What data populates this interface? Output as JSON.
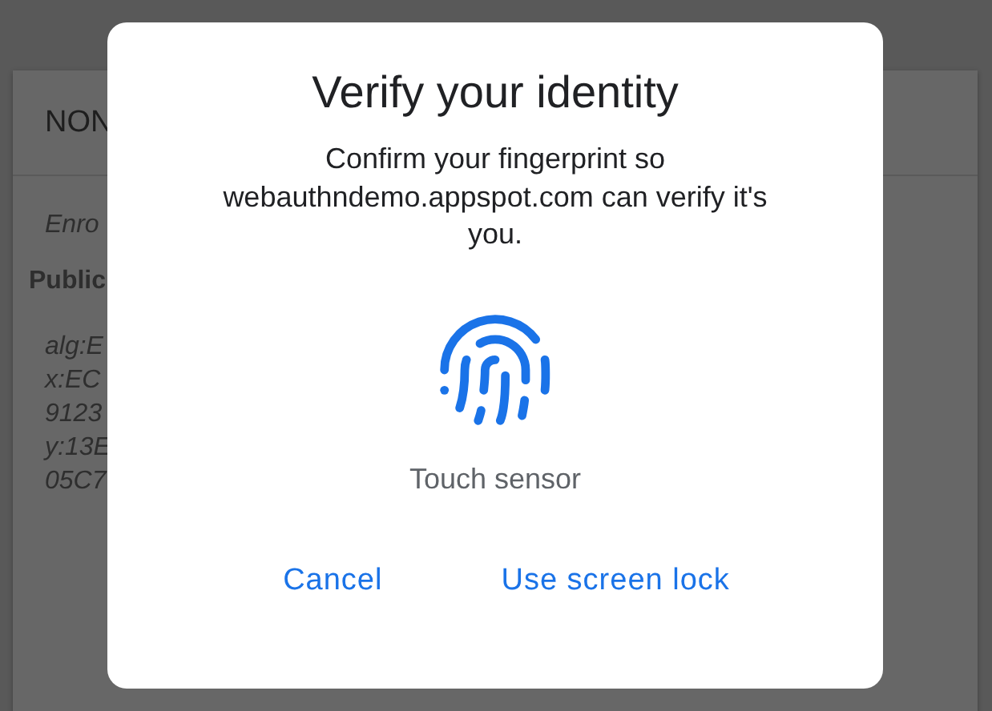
{
  "background_card": {
    "header": "NON",
    "lines": [
      {
        "text": "Enro",
        "kind": "italic"
      },
      {
        "text": "Public",
        "kind": "bold"
      },
      {
        "text": "alg:E",
        "kind": "key"
      },
      {
        "text": "x:EC",
        "kind": "key"
      },
      {
        "text": "9123",
        "kind": "key"
      },
      {
        "text": "y:13E",
        "kind": "key"
      },
      {
        "text": "05C7",
        "kind": "key"
      }
    ]
  },
  "dialog": {
    "title": "Verify your identity",
    "message": "Confirm your fingerprint so webauthndemo.appspot.com can verify it's you.",
    "sensor_label": "Touch sensor",
    "buttons": [
      "Cancel",
      "Use screen lock"
    ]
  }
}
